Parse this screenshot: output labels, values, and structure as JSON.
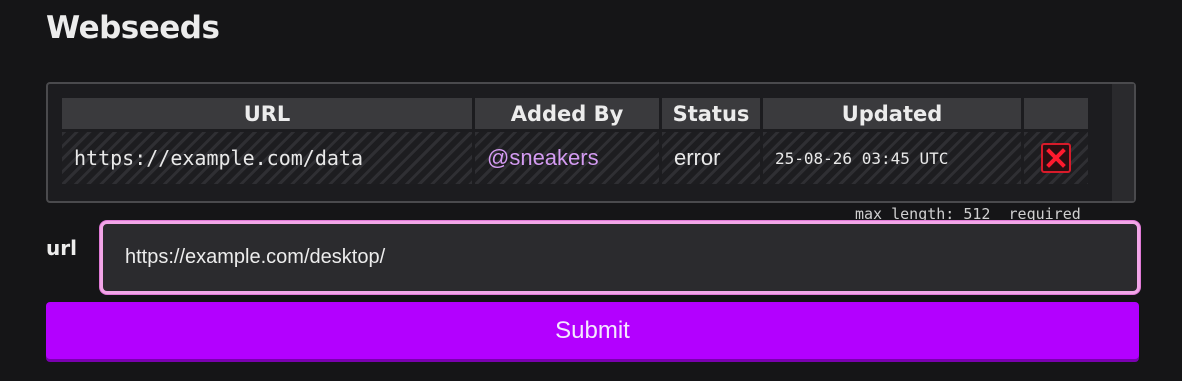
{
  "page": {
    "title": "Webseeds"
  },
  "table": {
    "headers": {
      "url": "URL",
      "added_by": "Added By",
      "status": "Status",
      "updated": "Updated",
      "actions": ""
    },
    "rows": [
      {
        "url": "https://example.com/data",
        "added_by": "@sneakers",
        "status": "error",
        "updated": "25-08-26 03:45 UTC",
        "delete_icon": "close-x-icon"
      }
    ]
  },
  "form": {
    "hint": "max length: 512  required",
    "url_label": "url",
    "url_value": "https://example.com/desktop/",
    "submit_label": "Submit"
  },
  "colors": {
    "background": "#151517",
    "accent": "#b300ff",
    "mention": "#d49bf2",
    "input_focus_border": "#f2a6e8",
    "delete_red": "#d81b2a"
  }
}
